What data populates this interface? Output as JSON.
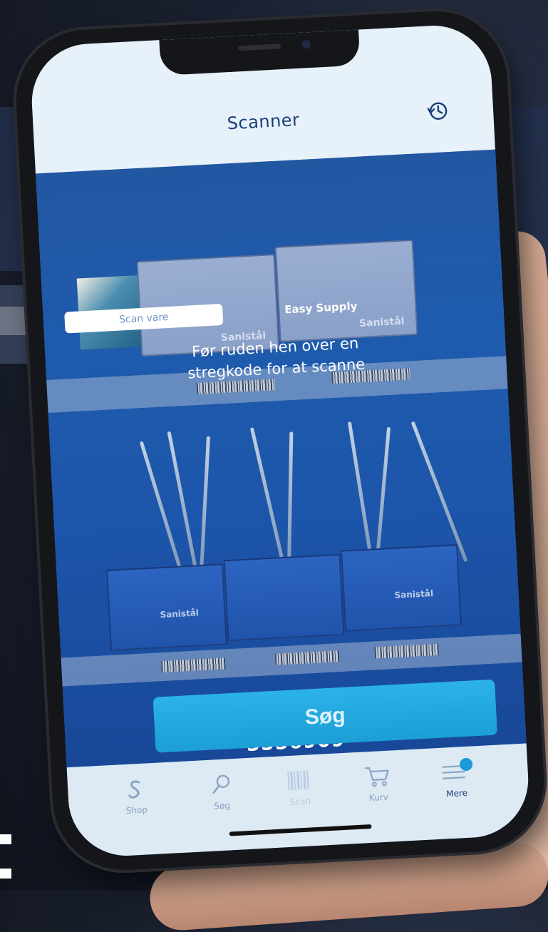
{
  "header": {
    "title": "Scanner",
    "history_icon": "history-icon"
  },
  "mode_switch": {
    "scan_label": "Scan vare",
    "easy_supply_label": "Easy Supply"
  },
  "instruction": {
    "line1": "Før ruden hen over en",
    "line2": "stregkode for at scanne"
  },
  "scanner": {
    "scanned_code": "3556909",
    "brand_text": "Sanistål"
  },
  "search_button": {
    "label": "Søg"
  },
  "tabbar": {
    "items": [
      {
        "label": "Shop",
        "icon": "sanistal-logo-icon"
      },
      {
        "label": "Søg",
        "icon": "search-icon"
      },
      {
        "label": "Scan",
        "icon": "barcode-icon"
      },
      {
        "label": "Kurv",
        "icon": "cart-icon"
      },
      {
        "label": "Mere",
        "icon": "menu-icon"
      }
    ]
  },
  "colors": {
    "accent": "#1c9fd6",
    "header_bg": "#e7f1f9",
    "title": "#1b3f7a",
    "camera_tint": "#1f5aa8"
  }
}
